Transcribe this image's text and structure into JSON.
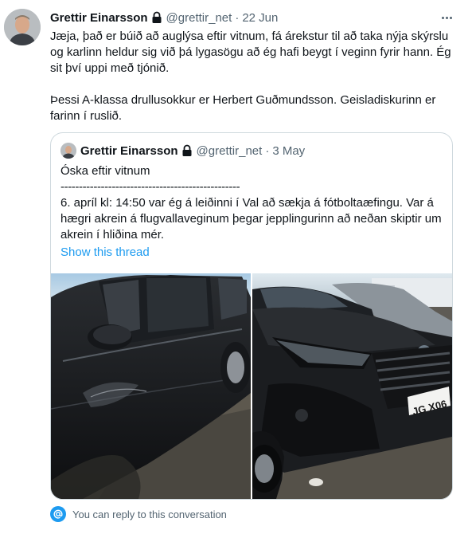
{
  "tweet": {
    "name": "Grettir Einarsson",
    "handle": "@grettir_net",
    "separator": "·",
    "date": "22 Jun",
    "paragraphs": [
      "Jæja, það er búið að auglýsa eftir vitnum, fá árekstur til að taka nýja skýrslu og karlinn heldur sig við þá lygasögu að ég hafi beygt í veginn fyrir hann. Ég sit því uppi með tjónið.",
      "Þessi A-klassa drullusokkur er Herbert Guðmundsson. Geisladiskurinn er farinn í ruslið."
    ]
  },
  "quoted": {
    "name": "Grettir Einarsson",
    "handle": "@grettir_net",
    "separator": "·",
    "date": "3 May",
    "line1": "Óska eftir vitnum",
    "line2": "-------------------------------------------------",
    "line3": "6. apríl kl: 14:50 var ég á leiðinni í Val að sækja á fótboltaæfingu. Var á hægri akrein á flugvallaveginum þegar jepplingurinn að neðan skiptir um akrein í hliðina mér.",
    "show_thread": "Show this thread"
  },
  "plate_text": "JG X06",
  "reply_note": "You can reply to this conversation",
  "colors": {
    "link": "#1d9bf0",
    "secondary": "#536471",
    "border": "#cfd9de"
  }
}
